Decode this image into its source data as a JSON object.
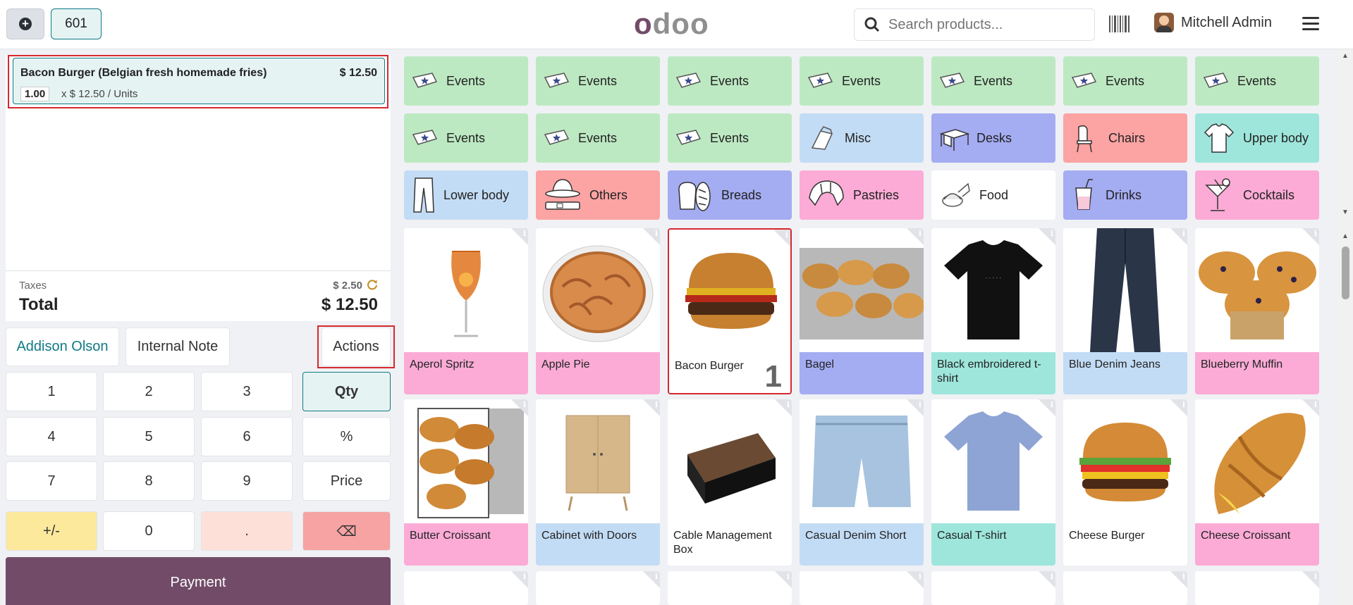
{
  "topbar": {
    "order_number": "601",
    "logo": "odoo",
    "search_placeholder": "Search products...",
    "user_name": "Mitchell Admin"
  },
  "order": {
    "lines": [
      {
        "name": "Bacon Burger (Belgian fresh homemade fries)",
        "price": "$ 12.50",
        "qty": "1.00",
        "unit": "x $ 12.50 / Units"
      }
    ],
    "taxes_label": "Taxes",
    "taxes_value": "$ 2.50",
    "total_label": "Total",
    "total_value": "$ 12.50"
  },
  "controls": {
    "customer": "Addison Olson",
    "note": "Internal Note",
    "actions": "Actions"
  },
  "numpad": {
    "keys": [
      "1",
      "2",
      "3",
      "Qty",
      "4",
      "5",
      "6",
      "%",
      "7",
      "8",
      "9",
      "Price",
      "+/-",
      "0",
      ".",
      "⌫"
    ]
  },
  "payment_label": "Payment",
  "categories": [
    {
      "label": "Events",
      "color": "#bde9c2",
      "icon": "ticket-icon"
    },
    {
      "label": "Events",
      "color": "#bde9c2",
      "icon": "ticket-icon"
    },
    {
      "label": "Events",
      "color": "#bde9c2",
      "icon": "ticket-icon"
    },
    {
      "label": "Events",
      "color": "#bde9c2",
      "icon": "ticket-icon"
    },
    {
      "label": "Events",
      "color": "#bde9c2",
      "icon": "ticket-icon"
    },
    {
      "label": "Events",
      "color": "#bde9c2",
      "icon": "ticket-icon"
    },
    {
      "label": "Events",
      "color": "#bde9c2",
      "icon": "ticket-icon"
    },
    {
      "label": "Events",
      "color": "#bde9c2",
      "icon": "ticket-icon"
    },
    {
      "label": "Events",
      "color": "#bde9c2",
      "icon": "ticket-icon"
    },
    {
      "label": "Events",
      "color": "#bde9c2",
      "icon": "ticket-icon"
    },
    {
      "label": "Misc",
      "color": "#c3dcf5",
      "icon": "misc-icon"
    },
    {
      "label": "Desks",
      "color": "#a4acf2",
      "icon": "desk-icon"
    },
    {
      "label": "Chairs",
      "color": "#fca3a3",
      "icon": "chair-icon"
    },
    {
      "label": "Upper body",
      "color": "#9ee6dc",
      "icon": "shirt-icon"
    },
    {
      "label": "Lower body",
      "color": "#c3dcf5",
      "icon": "pants-icon"
    },
    {
      "label": "Others",
      "color": "#fca3a3",
      "icon": "hat-icon"
    },
    {
      "label": "Breads",
      "color": "#a4acf2",
      "icon": "bread-icon"
    },
    {
      "label": "Pastries",
      "color": "#fbabd6",
      "icon": "croissant-icon"
    },
    {
      "label": "Food",
      "color": "#ffffff",
      "icon": "food-icon"
    },
    {
      "label": "Drinks",
      "color": "#a4acf2",
      "icon": "drink-icon"
    },
    {
      "label": "Cocktails",
      "color": "#fbabd6",
      "icon": "cocktail-icon"
    }
  ],
  "products": [
    {
      "name": "Aperol Spritz",
      "color": "#fbabd6",
      "icon": "cocktail-glass-icon"
    },
    {
      "name": "Apple Pie",
      "color": "#fbabd6",
      "icon": "pie-icon"
    },
    {
      "name": "Bacon Burger",
      "color": "#ffffff",
      "icon": "burger-icon",
      "qty": "1"
    },
    {
      "name": "Bagel",
      "color": "#a4acf2",
      "icon": "bagel-icon"
    },
    {
      "name": "Black embroidered t-shirt",
      "color": "#9ee6dc",
      "icon": "tshirt-icon"
    },
    {
      "name": "Blue Denim Jeans",
      "color": "#c3dcf5",
      "icon": "jeans-icon"
    },
    {
      "name": "Blueberry Muffin",
      "color": "#fbabd6",
      "icon": "muffin-icon"
    },
    {
      "name": "Butter Croissant",
      "color": "#fbabd6",
      "icon": "croissant-icon"
    },
    {
      "name": "Cabinet with Doors",
      "color": "#c3dcf5",
      "icon": "cabinet-icon"
    },
    {
      "name": "Cable Management Box",
      "color": "#ffffff",
      "icon": "box-icon"
    },
    {
      "name": "Casual Denim Short",
      "color": "#c3dcf5",
      "icon": "shorts-icon"
    },
    {
      "name": "Casual T-shirt",
      "color": "#9ee6dc",
      "icon": "tshirt-icon"
    },
    {
      "name": "Cheese Burger",
      "color": "#ffffff",
      "icon": "burger-icon"
    },
    {
      "name": "Cheese Croissant",
      "color": "#fbabd6",
      "icon": "croissant-icon"
    }
  ]
}
